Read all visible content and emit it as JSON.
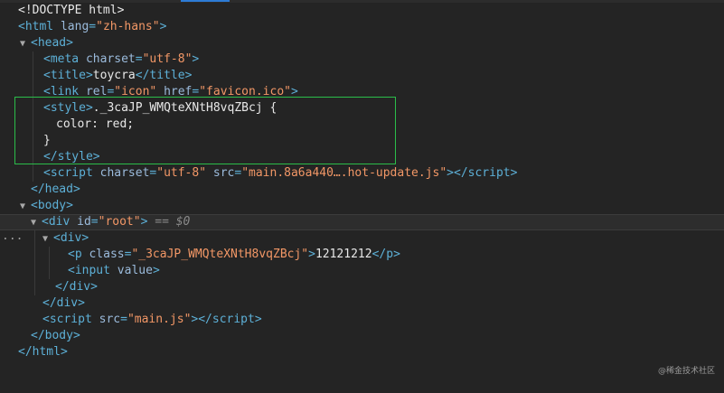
{
  "devtools": {
    "lines": [
      {
        "id": "doctype",
        "text": "<!DOCTYPE html>"
      },
      {
        "id": "html-open",
        "tag": "html",
        "attr": "lang",
        "val": "zh-hans"
      },
      {
        "id": "head-open",
        "tag": "head"
      },
      {
        "id": "meta",
        "tag": "meta",
        "attr": "charset",
        "val": "utf-8"
      },
      {
        "id": "title",
        "tag": "title",
        "text": "toycra"
      },
      {
        "id": "link",
        "tag": "link",
        "attr1": "rel",
        "val1": "icon",
        "attr2": "href",
        "val2": "favicon.ico"
      },
      {
        "id": "style-open",
        "tag": "style",
        "text": "._3caJP_WMQteXNtH8vqZBcj {"
      },
      {
        "id": "style-rule",
        "text": "color: red;"
      },
      {
        "id": "style-close-brace",
        "text": "}"
      },
      {
        "id": "style-close",
        "tag": "style"
      },
      {
        "id": "script-hot",
        "tag": "script",
        "attr1": "charset",
        "val1": "utf-8",
        "attr2": "src",
        "val2": "main.8a6a440….hot-update.js"
      },
      {
        "id": "head-close",
        "tag": "head"
      },
      {
        "id": "body-open",
        "tag": "body"
      },
      {
        "id": "div-root",
        "tag": "div",
        "attr": "id",
        "val": "root",
        "eq": "== $0"
      },
      {
        "id": "div-open",
        "tag": "div"
      },
      {
        "id": "p",
        "tag": "p",
        "attr": "class",
        "val": "_3caJP_WMQteXNtH8vqZBcj",
        "text": "12121212"
      },
      {
        "id": "input",
        "tag": "input",
        "attr": "value"
      },
      {
        "id": "div-close-inner",
        "tag": "div"
      },
      {
        "id": "div-close-outer",
        "tag": "div"
      },
      {
        "id": "script-main",
        "tag": "script",
        "attr": "src",
        "val": "main.js"
      },
      {
        "id": "body-close",
        "tag": "body"
      },
      {
        "id": "html-close",
        "tag": "html"
      }
    ],
    "ellipsis": "...",
    "watermark": "@稀金技术社区"
  },
  "colors": {
    "background": "#242424",
    "tag": "#5db0d7",
    "attribute": "#9bbbdc",
    "value": "#f29766",
    "highlight": "#2bbd4a"
  }
}
